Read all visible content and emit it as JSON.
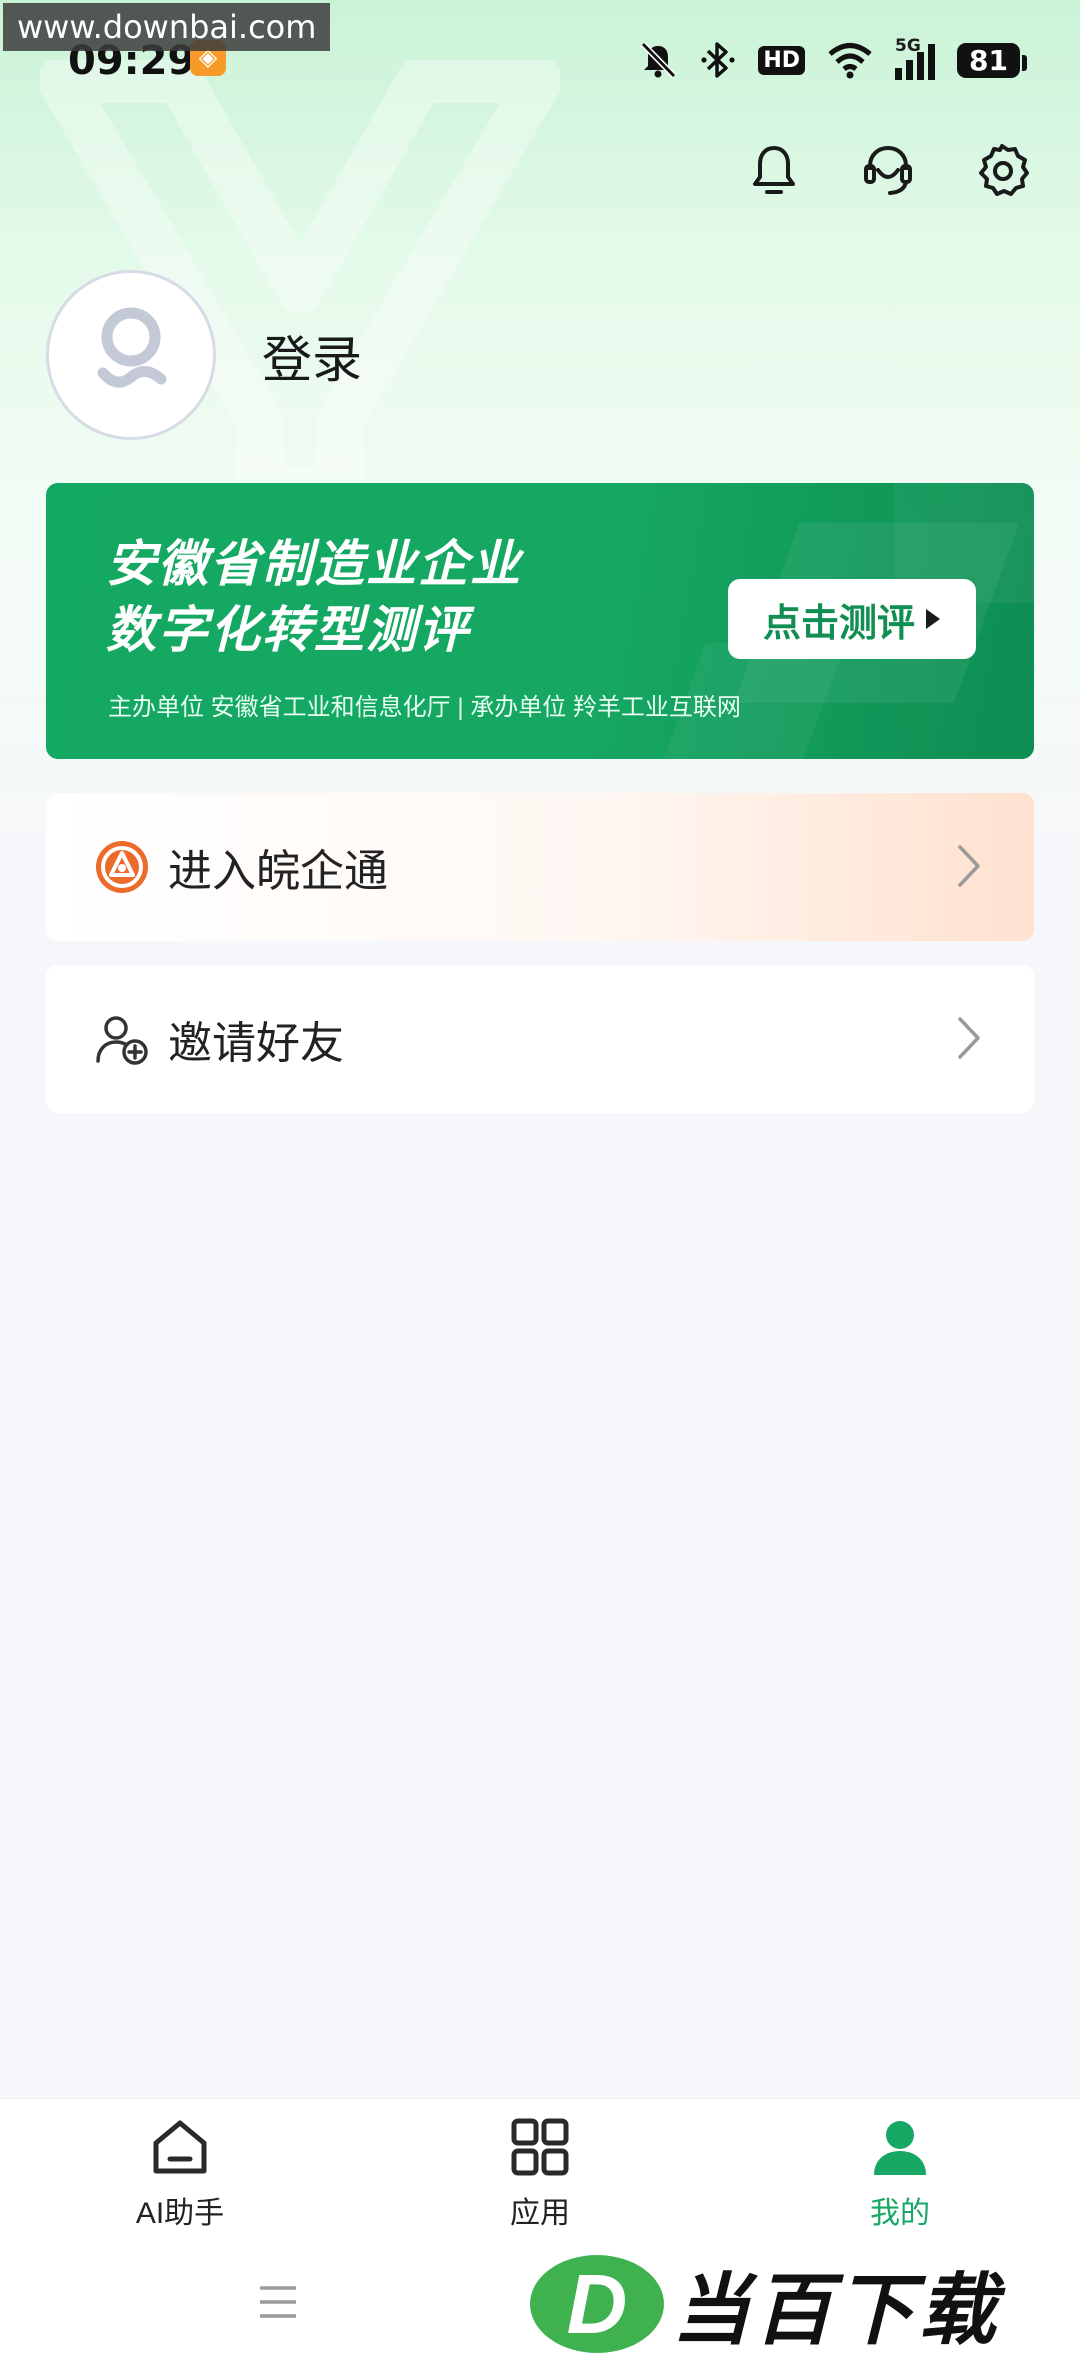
{
  "watermark": "www.downbai.com",
  "status_bar": {
    "time": "09:29",
    "hd": "HD",
    "network": "5G",
    "battery": "81"
  },
  "profile": {
    "login_label": "登录"
  },
  "banner": {
    "title_line1": "安徽省制造业企业",
    "title_line2": "数字化转型测评",
    "cta_label": "点击测评",
    "sub": "主办单位  安徽省工业和信息化厅  |  承办单位  羚羊工业互联网"
  },
  "menu": [
    {
      "label": "进入皖企通",
      "icon": "wanqitong-logo-icon"
    },
    {
      "label": "邀请好友",
      "icon": "add-user-icon"
    }
  ],
  "tabs": [
    {
      "label": "AI助手",
      "icon": "home-icon"
    },
    {
      "label": "应用",
      "icon": "grid-icon"
    },
    {
      "label": "我的",
      "icon": "person-icon",
      "active": true
    }
  ],
  "brand_watermark": {
    "letter": "D",
    "text": "当百下载"
  },
  "colors": {
    "accent": "#17a865",
    "banner": "#13a862",
    "orange": "#ec6a2a"
  }
}
